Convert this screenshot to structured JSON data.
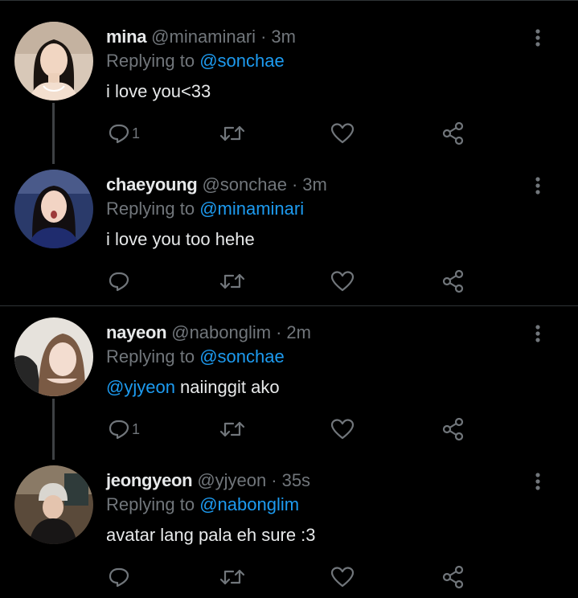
{
  "replying_prefix": "Replying to",
  "colors": {
    "background": "#000000",
    "text": "#e7e9ea",
    "muted": "#71767b",
    "accent": "#1d9bf0",
    "divider": "#2f3336"
  },
  "tweets": [
    {
      "name": "mina",
      "handle": "@minaminari",
      "separator": "·",
      "time": "3m",
      "replying_to": "@sonchae",
      "mention": "",
      "text": "i love you<33",
      "reply_count": "1",
      "avatar_icon": "avatar-photo"
    },
    {
      "name": "chaeyoung",
      "handle": "@sonchae",
      "separator": "·",
      "time": "3m",
      "replying_to": "@minaminari",
      "mention": "",
      "text": "i love you too hehe",
      "reply_count": "",
      "avatar_icon": "avatar-photo"
    },
    {
      "name": "nayeon",
      "handle": "@nabonglim",
      "separator": "·",
      "time": "2m",
      "replying_to": "@sonchae",
      "mention": "@yjyeon",
      "text": " naiinggit ako",
      "reply_count": "1",
      "avatar_icon": "avatar-photo"
    },
    {
      "name": "jeongyeon",
      "handle": "@yjyeon",
      "separator": "·",
      "time": "35s",
      "replying_to": "@nabonglim",
      "mention": "",
      "text": "avatar lang pala eh sure :3",
      "reply_count": "",
      "avatar_icon": "avatar-photo"
    }
  ],
  "action_icons": [
    "reply-icon",
    "retweet-icon",
    "like-icon",
    "share-icon",
    "more-icon"
  ]
}
